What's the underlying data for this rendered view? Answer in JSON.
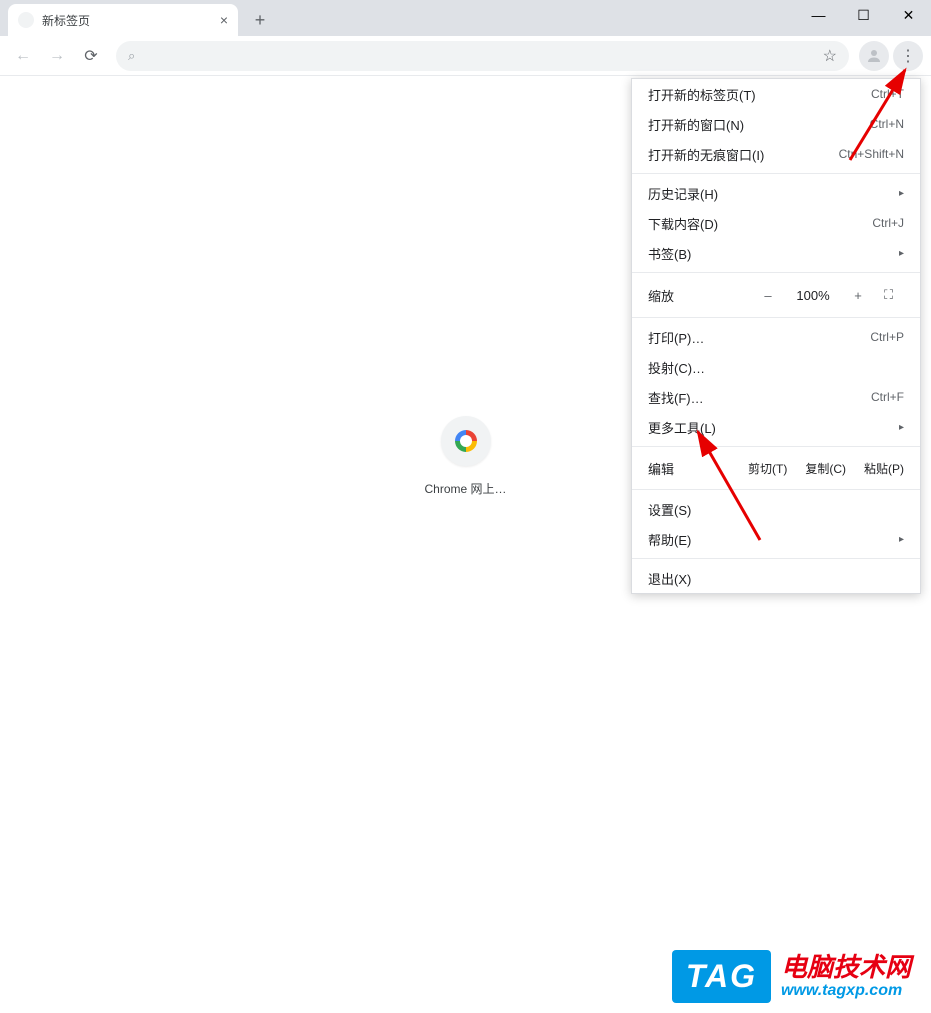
{
  "window": {
    "tab_title": "新标签页",
    "close_glyph": "×",
    "newtab_glyph": "+",
    "minimize_glyph": "—",
    "maximize_glyph": "☐",
    "winclose_glyph": "✕"
  },
  "toolbar": {
    "back_glyph": "←",
    "forward_glyph": "→",
    "reload_glyph": "⟳",
    "search_glyph": "⌕",
    "address_value": "",
    "star_glyph": "☆",
    "profile_glyph": "👤",
    "menu_glyph": "⋮"
  },
  "content": {
    "app_label": "Chrome 网上…"
  },
  "menu": {
    "new_tab": {
      "label": "打开新的标签页(T)",
      "shortcut": "Ctrl+T"
    },
    "new_window": {
      "label": "打开新的窗口(N)",
      "shortcut": "Ctrl+N"
    },
    "incognito": {
      "label": "打开新的无痕窗口(I)",
      "shortcut": "Ctrl+Shift+N"
    },
    "history": {
      "label": "历史记录(H)",
      "arrow": "▸"
    },
    "downloads": {
      "label": "下载内容(D)",
      "shortcut": "Ctrl+J"
    },
    "bookmarks": {
      "label": "书签(B)",
      "arrow": "▸"
    },
    "zoom": {
      "label": "缩放",
      "minus": "–",
      "value": "100%",
      "plus": "+",
      "full": "⛶"
    },
    "print": {
      "label": "打印(P)…",
      "shortcut": "Ctrl+P"
    },
    "cast": {
      "label": "投射(C)…"
    },
    "find": {
      "label": "查找(F)…",
      "shortcut": "Ctrl+F"
    },
    "more_tools": {
      "label": "更多工具(L)",
      "arrow": "▸"
    },
    "edit": {
      "label": "编辑",
      "cut": "剪切(T)",
      "copy": "复制(C)",
      "paste": "粘贴(P)"
    },
    "settings": {
      "label": "设置(S)"
    },
    "help": {
      "label": "帮助(E)",
      "arrow": "▸"
    },
    "exit": {
      "label": "退出(X)"
    }
  },
  "watermark": {
    "tag": "TAG",
    "line1": "电脑技术网",
    "line2": "www.tagxp.com"
  }
}
